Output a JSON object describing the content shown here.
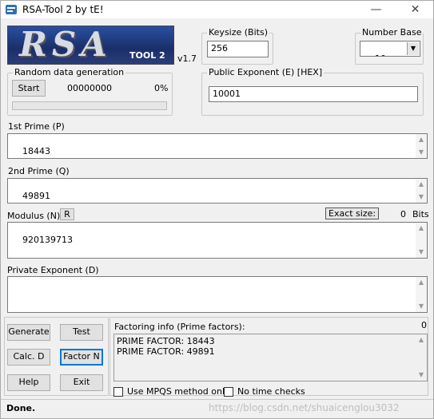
{
  "window": {
    "title": "RSA-Tool 2 by tE!",
    "minimize": "—",
    "maximize": "☐",
    "close": "✕"
  },
  "logo": {
    "text_main": "RSA",
    "text_sub": "TOOL 2",
    "version": "v1.7"
  },
  "keysize": {
    "label": "Keysize (Bits)",
    "value": "256"
  },
  "number_base": {
    "label": "Number Base",
    "value": "10"
  },
  "random": {
    "label": "Random data generation",
    "start_label": "Start",
    "counter": "00000000",
    "percent": "0%",
    "progress": 0
  },
  "public_exponent": {
    "label": "Public Exponent (E) [HEX]",
    "value": "10001"
  },
  "prime_p": {
    "label": "1st Prime (P)",
    "value": "18443"
  },
  "prime_q": {
    "label": "2nd Prime (Q)",
    "value": "49891"
  },
  "modulus": {
    "label": "Modulus (N)",
    "r_label": "R",
    "exact_size_label": "Exact size:",
    "exact_size_value": "0",
    "bits_label": "Bits",
    "value": "920139713"
  },
  "private_exponent": {
    "label": "Private Exponent (D)",
    "value": ""
  },
  "buttons": {
    "generate": "Generate",
    "test": "Test",
    "calc_d": "Calc. D",
    "factor_n": "Factor N",
    "help": "Help",
    "exit": "Exit"
  },
  "factoring": {
    "label": "Factoring info (Prime factors):",
    "count": "0",
    "lines": [
      "PRIME FACTOR: 18443",
      "PRIME FACTOR: 49891"
    ]
  },
  "options": {
    "mpqs_label": "Use MPQS method only",
    "no_time_label": "No time checks"
  },
  "status": {
    "text": "Done.",
    "watermark": "https://blog.csdn.net/shuaicenglou3032"
  },
  "icons": {
    "app": "app-icon",
    "scroll_up": "scroll-up-icon",
    "scroll_down": "scroll-down-icon",
    "dropdown": "chevron-down-icon"
  }
}
